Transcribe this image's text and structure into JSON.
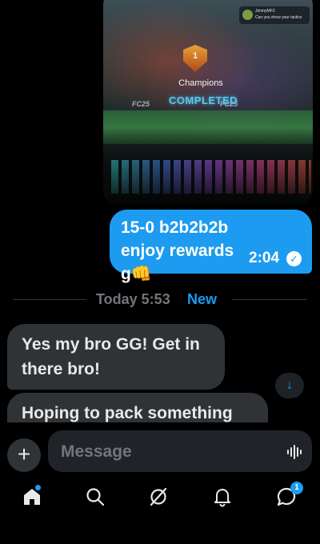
{
  "photo": {
    "notification": {
      "name": "JimmyMFC",
      "text": "Can you show your tactics"
    },
    "shield_digit": "1",
    "title": "Champions",
    "status": "COMPLETED",
    "brand": "FC25"
  },
  "outgoing_message": {
    "text": "15-0 b2b2b2b enjoy rewards g👊",
    "time": "2:04",
    "read_icon": "check-circle-icon"
  },
  "divider": {
    "label": "Today 5:53",
    "new_label": "New"
  },
  "incoming_messages": [
    {
      "text": "Yes my bro GG! Get in there bro!"
    },
    {
      "text": "Hoping to pack something"
    }
  ],
  "scroll_button": {
    "icon": "arrow-down-icon",
    "glyph": "↓"
  },
  "composer": {
    "placeholder": "Message",
    "plus_glyph": "+",
    "voice_icon": "voice-wave-icon"
  },
  "nav": {
    "items": [
      {
        "name": "home",
        "icon": "home-icon"
      },
      {
        "name": "search",
        "icon": "search-icon"
      },
      {
        "name": "grok",
        "icon": "grok-icon"
      },
      {
        "name": "notifications",
        "icon": "bell-icon"
      },
      {
        "name": "messages",
        "icon": "messages-icon",
        "badge": "1"
      }
    ]
  },
  "colors": {
    "accent": "#1d9bf0",
    "bubble_in": "#2f3336",
    "background": "#000000"
  }
}
